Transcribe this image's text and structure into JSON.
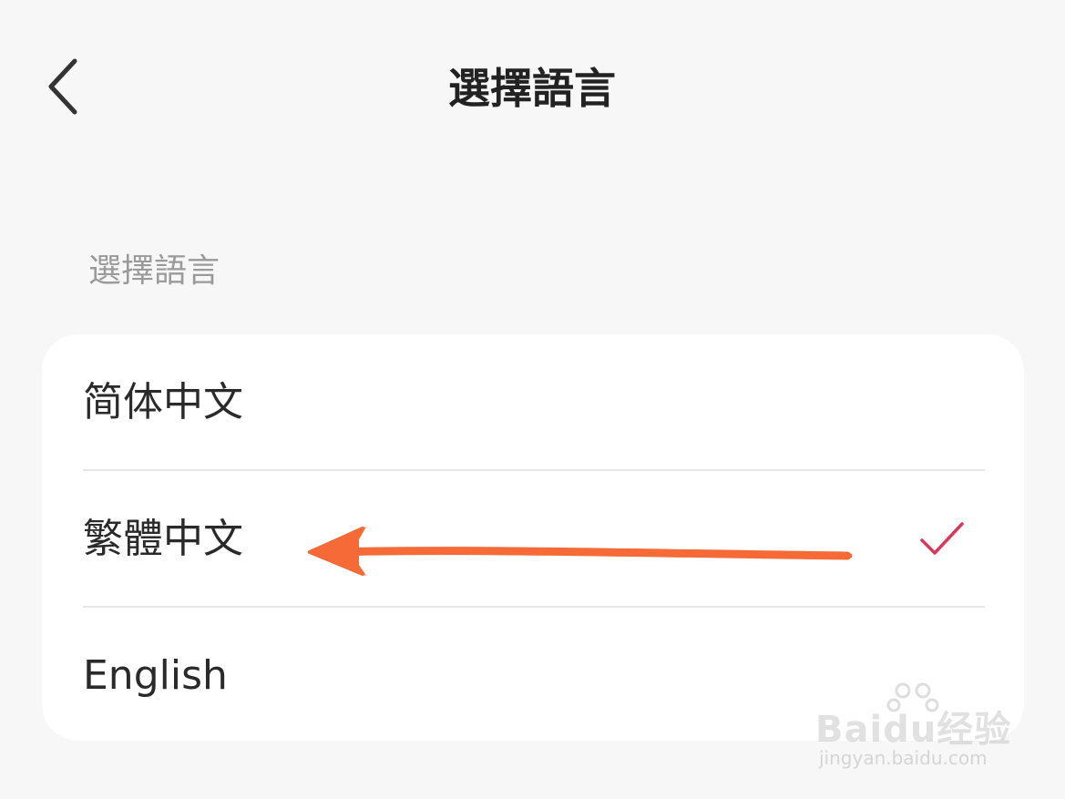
{
  "header": {
    "title": "選擇語言",
    "back_icon": "chevron-left-icon"
  },
  "section": {
    "label": "選擇語言"
  },
  "languages": [
    {
      "label": "简体中文",
      "selected": false
    },
    {
      "label": "繁體中文",
      "selected": true
    },
    {
      "label": "English",
      "selected": false
    }
  ],
  "colors": {
    "background": "#f7f7f7",
    "card": "#ffffff",
    "check": "#d63a5a",
    "annotation_arrow": "#f56a36",
    "section_label": "#9a9a9a"
  },
  "annotation": {
    "icon": "arrow-left-annotation"
  },
  "watermark": {
    "brand": "Baidu经验",
    "url": "jingyan.baidu.com"
  }
}
